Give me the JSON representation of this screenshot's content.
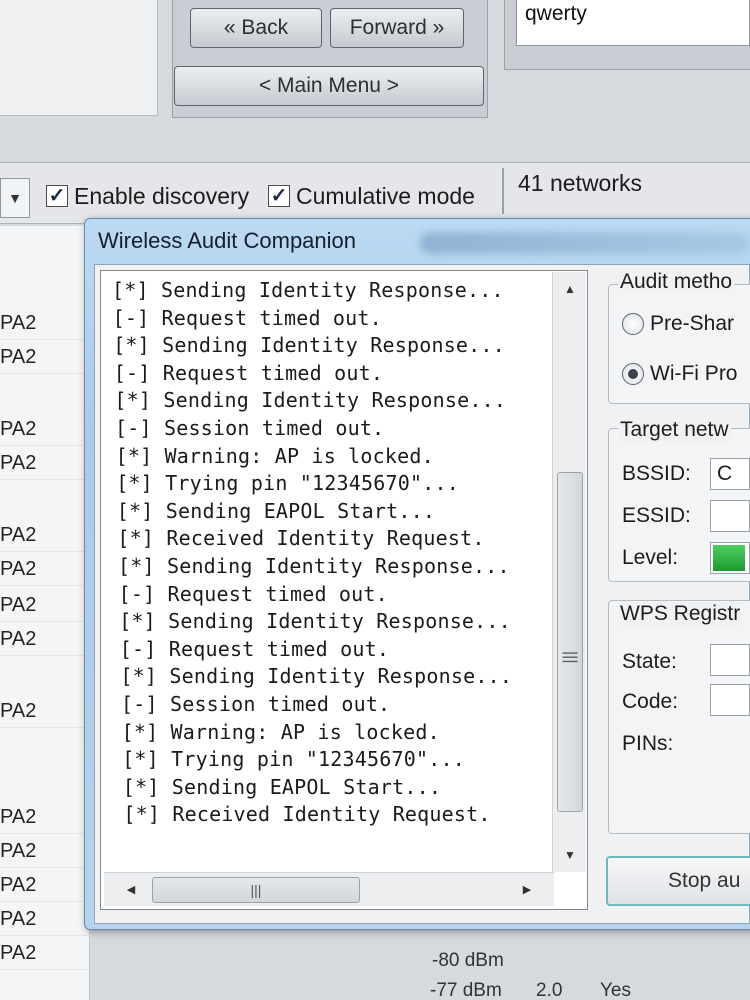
{
  "navigation": {
    "back_label": "« Back",
    "forward_label": "Forward »",
    "main_menu_label": "< Main Menu >"
  },
  "key_input": {
    "value": "qwerty"
  },
  "toolbar": {
    "dropdown_icon": "chevron-down-icon",
    "enable_discovery": {
      "label": "Enable discovery",
      "checked": true
    },
    "cumulative_mode": {
      "label": "Cumulative mode",
      "checked": true
    },
    "network_count": "41 networks"
  },
  "background_list": {
    "rows": [
      "PA2",
      "PA2",
      "PA2",
      "PA2",
      "PA2",
      "PA2",
      "PA2",
      "PA2",
      "PA2",
      "PA2",
      "PA2",
      "PA2",
      "PA2",
      "PA2"
    ],
    "bottom_texts": [
      "-80 dBm",
      "-77 dBm",
      "2.0",
      "Yes"
    ]
  },
  "dialog": {
    "title": "Wireless Audit Companion",
    "log_lines": [
      "[*] Sending Identity Response...",
      "[-] Request timed out.",
      "[*] Sending Identity Response...",
      "[-] Request timed out.",
      "[*] Sending Identity Response...",
      "[-] Session timed out.",
      "[*] Warning: AP is locked.",
      "[*] Trying pin \"12345670\"...",
      "[*] Sending EAPOL Start...",
      "[*] Received Identity Request.",
      "[*] Sending Identity Response...",
      "[-] Request timed out.",
      "[*] Sending Identity Response...",
      "[-] Request timed out.",
      "[*] Sending Identity Response...",
      "[-] Session timed out.",
      "[*] Warning: AP is locked.",
      "[*] Trying pin \"12345670\"...",
      "[*] Sending EAPOL Start...",
      "[*] Received Identity Request."
    ],
    "audit_method": {
      "title": "Audit metho",
      "options": [
        {
          "label": "Pre-Shar",
          "selected": false
        },
        {
          "label": "Wi-Fi Pro",
          "selected": true
        }
      ]
    },
    "target_network": {
      "title": "Target netw",
      "bssid_label": "BSSID:",
      "bssid_value": "C",
      "essid_label": "ESSID:",
      "essid_value": "",
      "level_label": "Level:",
      "level_fraction": 0.9
    },
    "wps_registrar": {
      "title": "WPS Registr",
      "state_label": "State:",
      "state_value": "",
      "code_label": "Code:",
      "code_value": "",
      "pins_label": "PINs:"
    },
    "stop_label": "Stop au"
  }
}
